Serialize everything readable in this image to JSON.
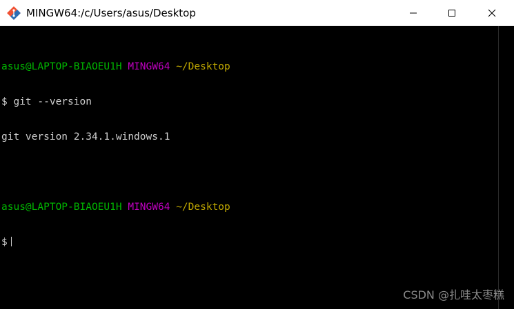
{
  "window": {
    "title": "MINGW64:/c/Users/asus/Desktop",
    "controls": {
      "minimize_icon": "minimize-icon",
      "maximize_icon": "maximize-icon",
      "close_icon": "close-icon"
    }
  },
  "terminal": {
    "colors": {
      "background": "#000000",
      "user_host": "#00b800",
      "shell": "#c000c0",
      "path": "#c0a800",
      "text": "#bfbfbf"
    },
    "prompt1": {
      "user_host": "asus@LAPTOP-BIAOEU1H",
      "shell": "MINGW64",
      "path": "~/Desktop"
    },
    "command1": {
      "symbol": "$",
      "text": "git --version"
    },
    "output1": "git version 2.34.1.windows.1",
    "prompt2": {
      "user_host": "asus@LAPTOP-BIAOEU1H",
      "shell": "MINGW64",
      "path": "~/Desktop"
    },
    "command2": {
      "symbol": "$",
      "text": ""
    }
  },
  "watermark": "CSDN @扎哇太枣糕"
}
